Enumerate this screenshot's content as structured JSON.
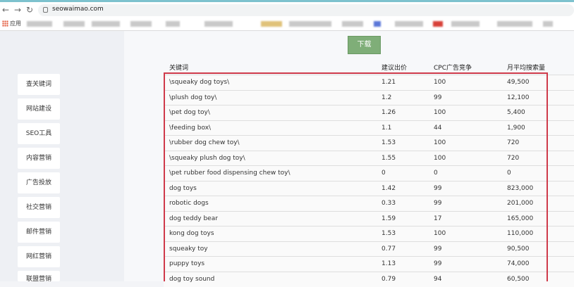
{
  "browser": {
    "url": "seowaimao.com",
    "bookmarks_label": "应用"
  },
  "sidebar": {
    "items": [
      {
        "label": "查关键词"
      },
      {
        "label": "网站建设"
      },
      {
        "label": "SEO工具"
      },
      {
        "label": "内容营销"
      },
      {
        "label": "广告投放"
      },
      {
        "label": "社交营销"
      },
      {
        "label": "邮件营销"
      },
      {
        "label": "网红营销"
      },
      {
        "label": "联盟营销"
      }
    ]
  },
  "toolbar": {
    "download_label": "下载"
  },
  "table": {
    "headers": {
      "keyword": "关键词",
      "bid": "建议出价",
      "cpc": "CPC广告竞争",
      "volume": "月平均搜索量"
    },
    "rows": [
      {
        "keyword": "\\squeaky dog toys\\",
        "bid": "1.21",
        "cpc": "100",
        "volume": "49,500"
      },
      {
        "keyword": "\\plush dog toy\\",
        "bid": "1.2",
        "cpc": "99",
        "volume": "12,100"
      },
      {
        "keyword": "\\pet dog toy\\",
        "bid": "1.26",
        "cpc": "100",
        "volume": "5,400"
      },
      {
        "keyword": "\\feeding box\\",
        "bid": "1.1",
        "cpc": "44",
        "volume": "1,900"
      },
      {
        "keyword": "\\rubber dog chew toy\\",
        "bid": "1.53",
        "cpc": "100",
        "volume": "720"
      },
      {
        "keyword": "\\squeaky plush dog toy\\",
        "bid": "1.55",
        "cpc": "100",
        "volume": "720"
      },
      {
        "keyword": "\\pet rubber food dispensing chew toy\\",
        "bid": "0",
        "cpc": "0",
        "volume": "0"
      },
      {
        "keyword": "dog toys",
        "bid": "1.42",
        "cpc": "99",
        "volume": "823,000"
      },
      {
        "keyword": "robotic dogs",
        "bid": "0.33",
        "cpc": "99",
        "volume": "201,000"
      },
      {
        "keyword": "dog teddy bear",
        "bid": "1.59",
        "cpc": "17",
        "volume": "165,000"
      },
      {
        "keyword": "kong dog toys",
        "bid": "1.53",
        "cpc": "100",
        "volume": "110,000"
      },
      {
        "keyword": "squeaky toy",
        "bid": "0.77",
        "cpc": "99",
        "volume": "90,500"
      },
      {
        "keyword": "puppy toys",
        "bid": "1.13",
        "cpc": "99",
        "volume": "74,000"
      },
      {
        "keyword": "dog toy sound",
        "bid": "0.79",
        "cpc": "94",
        "volume": "60,500"
      }
    ]
  },
  "colors": {
    "highlight_border": "#cf3a4a",
    "download_button": "#7fae78",
    "accent_topline": "#7dc2ce"
  }
}
